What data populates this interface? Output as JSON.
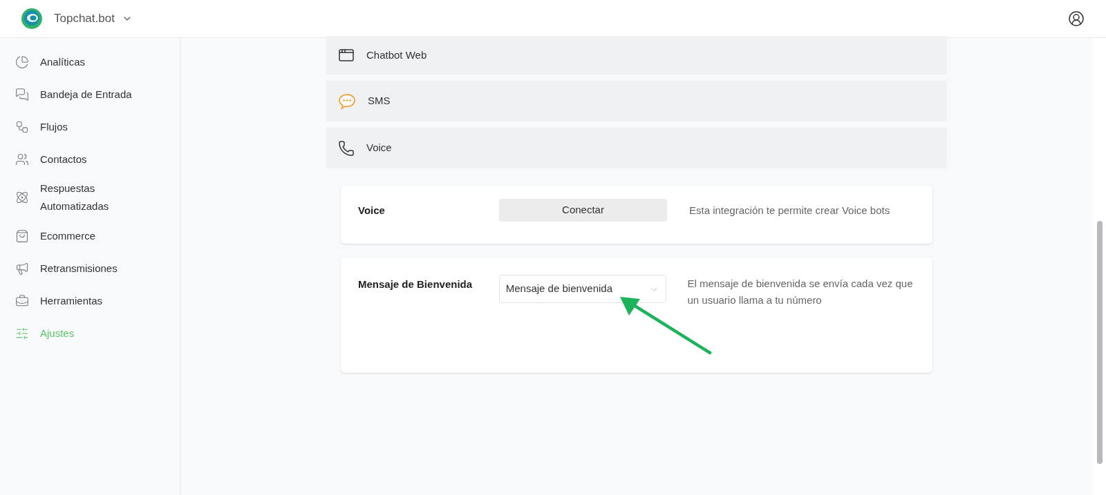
{
  "header": {
    "brand": "Topchat.bot"
  },
  "sidebar": {
    "items": [
      {
        "label": "Analíticas",
        "selected": false
      },
      {
        "label": "Bandeja de Entrada",
        "selected": false
      },
      {
        "label": "Flujos",
        "selected": false
      },
      {
        "label": "Contactos",
        "selected": false
      },
      {
        "label": "Respuestas Automatizadas",
        "selected": false
      },
      {
        "label": "Ecommerce",
        "selected": false
      },
      {
        "label": "Retransmisiones",
        "selected": false
      },
      {
        "label": "Herramientas",
        "selected": false
      },
      {
        "label": "Ajustes",
        "selected": true
      }
    ]
  },
  "channels": [
    {
      "kind": "web",
      "label": "Chatbot Web"
    },
    {
      "kind": "sms",
      "label": "SMS"
    },
    {
      "kind": "voice",
      "label": "Voice"
    }
  ],
  "voice_card": {
    "title": "Voice",
    "button": "Conectar",
    "description": "Esta integración te permite crear Voice bots"
  },
  "welcome_card": {
    "title": "Mensaje de Bienvenida",
    "select_value": "Mensaje de bienvenida",
    "description": "El mensaje de bienvenida se envía cada vez que un usuario llama a tu número"
  }
}
